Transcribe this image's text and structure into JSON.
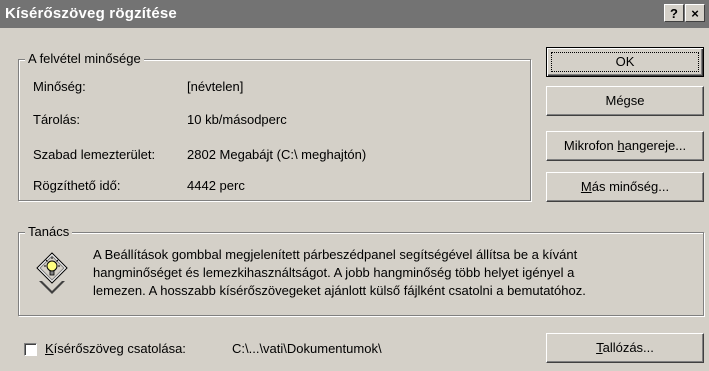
{
  "window": {
    "title": "Kísérőszöveg rögzítése",
    "help_button": "?",
    "close_button": "×"
  },
  "quality_group": {
    "legend": "A felvétel minősége",
    "rows": [
      {
        "label": "Minőség:",
        "value": "[névtelen]"
      },
      {
        "label": "Tárolás:",
        "value": "10 kb/másodperc"
      },
      {
        "label": "Szabad lemezterület:",
        "value": "2802 Megabájt (C:\\ meghajtón)"
      },
      {
        "label": "Rögzíthető idő:",
        "value": "4442 perc"
      }
    ]
  },
  "buttons": {
    "ok": "OK",
    "cancel": "Mégse",
    "microphone_prefix": "Mikrofon ",
    "microphone_hotkey": "h",
    "microphone_suffix": "angereje...",
    "other_hotkey": "M",
    "other_suffix": "ás minőség...",
    "browse_hotkey": "T",
    "browse_suffix": "allózás..."
  },
  "tip_group": {
    "legend": "Tanács",
    "lines": [
      "A Beállítások gombbal megjelenített párbeszédpanel segítségével állítsa be a kívánt",
      "hangminőséget és lemezkihasználtságot. A jobb hangminőség több helyet igényel a",
      "lemezen. A hosszabb kísérőszövegeket ajánlott külső fájlként csatolni a bemutatóhoz."
    ]
  },
  "link": {
    "checkbox_hotkey": "K",
    "checkbox_suffix": "ísérőszöveg csatolása:",
    "checked": false,
    "path": "C:\\...\\vati\\Dokumentumok\\"
  }
}
